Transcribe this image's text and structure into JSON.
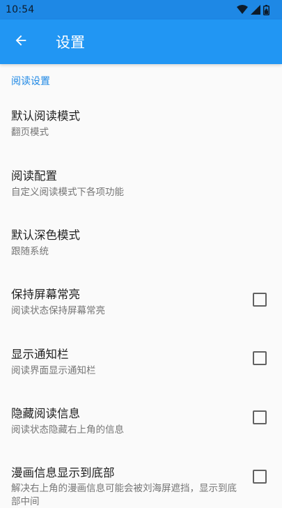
{
  "status_bar": {
    "time": "10:54",
    "icons": [
      "wifi-icon",
      "signal-icon",
      "battery-icon"
    ]
  },
  "app_bar": {
    "back_icon": "arrow-left-icon",
    "title": "设置",
    "color": "#2196f3"
  },
  "section": {
    "title": "阅读设置",
    "color": "#1e88e5"
  },
  "preferences": [
    {
      "title": "默认阅读模式",
      "summary": "翻页模式"
    },
    {
      "title": "阅读配置",
      "summary": "自定义阅读模式下各项功能"
    },
    {
      "title": "默认深色模式",
      "summary": "跟随系统"
    },
    {
      "title": "保持屏幕常亮",
      "summary": "阅读状态保持屏幕常亮",
      "checked": false
    },
    {
      "title": "显示通知栏",
      "summary": "阅读界面显示通知栏",
      "checked": false
    },
    {
      "title": "隐藏阅读信息",
      "summary": "阅读状态隐藏右上角的信息",
      "checked": false
    },
    {
      "title": "漫画信息显示到底部",
      "summary": "解决右上角的漫画信息可能会被刘海屏遮挡，显示到底部中间",
      "checked": false
    }
  ]
}
